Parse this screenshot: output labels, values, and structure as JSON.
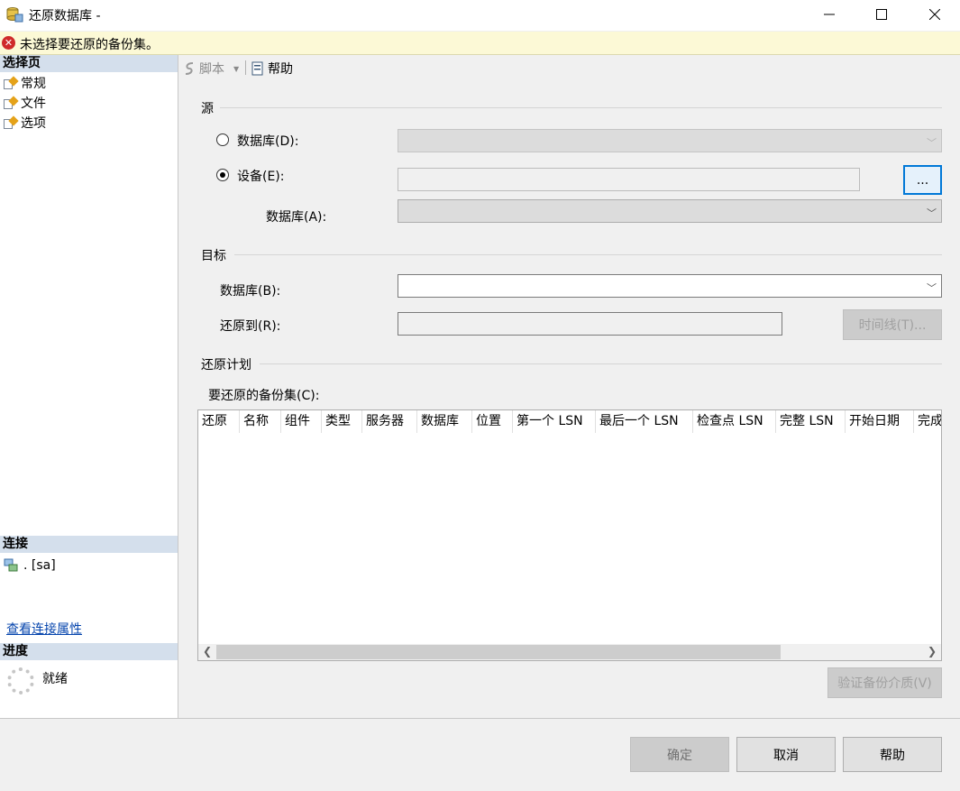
{
  "window": {
    "title": "还原数据库 -",
    "minimize": "—",
    "maximize": "☐",
    "close": "✕"
  },
  "error": {
    "message": "未选择要还原的备份集。"
  },
  "left": {
    "select_page_heading": "选择页",
    "pages": [
      {
        "label": "常规"
      },
      {
        "label": "文件"
      },
      {
        "label": "选项"
      }
    ],
    "connection_heading": "连接",
    "connection_value": ". [sa]",
    "view_connection_link": "查看连接属性",
    "progress_heading": "进度",
    "progress_status": "就绪"
  },
  "toolbar": {
    "script_label": "脚本",
    "help_label": "帮助"
  },
  "source": {
    "heading": "源",
    "database_radio": "数据库(D):",
    "device_radio": "设备(E):",
    "browse_button": "...",
    "database_label": "数据库(A):"
  },
  "target": {
    "heading": "目标",
    "database_label": "数据库(B):",
    "restore_to_label": "还原到(R):",
    "timeline_button": "时间线(T)..."
  },
  "plan": {
    "heading": "还原计划",
    "backup_sets_label": "要还原的备份集(C):",
    "columns": [
      "还原",
      "名称",
      "组件",
      "类型",
      "服务器",
      "数据库",
      "位置",
      "第一个 LSN",
      "最后一个 LSN",
      "检查点 LSN",
      "完整 LSN",
      "开始日期",
      "完成"
    ],
    "verify_button": "验证备份介质(V)"
  },
  "footer": {
    "ok": "确定",
    "cancel": "取消",
    "help": "帮助"
  }
}
